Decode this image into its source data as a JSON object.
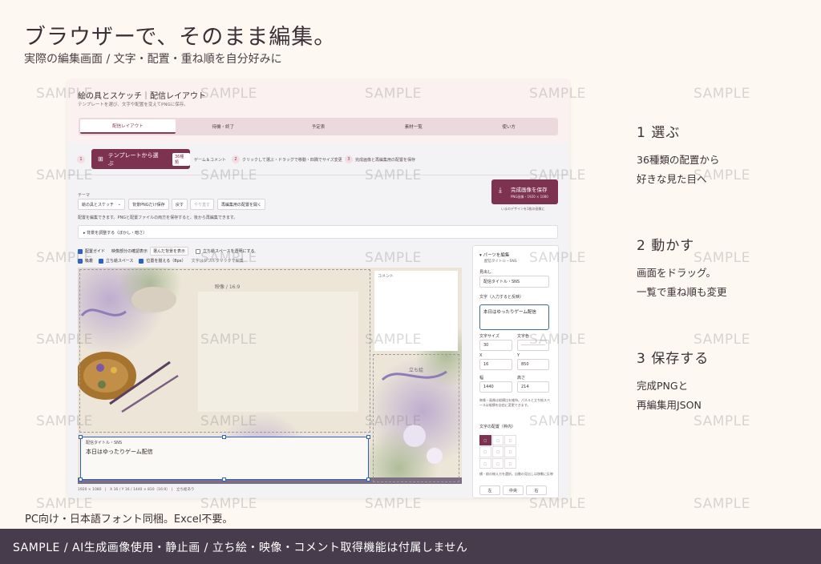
{
  "hero": {
    "title": "ブラウザーで、そのまま編集。",
    "subtitle": "実際の編集画面 / 文字・配置・重ね順を自分好みに"
  },
  "app": {
    "title": "絵の具とスケッチ｜配信レイアウト",
    "description": "テンプレートを選び、文字や配置を変えてPNGに保存。",
    "tabs": [
      "配信レイアウト",
      "待機・終了",
      "予定表",
      "素材一覧",
      "使い方"
    ],
    "steps": {
      "template_button": "テンプレートから選ぶ",
      "template_badge": "36種類",
      "after_button": "ゲーム＆コメント",
      "step2": "クリックして選ぶ・ドラッグで移動・四隅でサイズ変更",
      "step3": "完成画像と再編集用の配置を保存",
      "num1": "1",
      "num2": "2",
      "num3": "3"
    },
    "save": {
      "label": "完成画像を保存",
      "sub": "PNG画像・1920 × 1080",
      "note": "いまのデザインを1枚の画像に"
    },
    "theme_label": "テーマ",
    "controls": {
      "theme_select": "絵の具とスケッチ",
      "bg_png": "背景PNGだけ保存",
      "undo": "戻す",
      "redo": "やり直す",
      "load_layout": "再編集用の配置を開く"
    },
    "edit_hint": "配置を編集できます。PNGと配置ファイルの両方を保存すると、後から再編集できます。",
    "bg_adjust": "▸ 背景を調整する（ぼかし・暗さ）",
    "options": {
      "guide": "配置ガイド",
      "video_preview_label": "映像部分の確認表示",
      "video_preview_select": "選んだ背景を表示",
      "transparent": "立ち絵スペースを透明にする",
      "snap": "吸着",
      "stand_space": "立ち絵スペース",
      "align_grid": "位置を揃える（8px）",
      "hint": "文字はダブルクリックで編集"
    },
    "canvas": {
      "video_label": "映像 / 16:9",
      "comment_label": "コメント",
      "stand_label": "立ち絵",
      "title_small": "配信タイトル・SNS",
      "title_text": "本日はゆったりゲーム配信",
      "status": "1920 × 1080　|　X 16 / Y 16 / 1440 × 810（16:9）　|　立ち絵あり"
    },
    "panel": {
      "header": "▾ パーツを編集",
      "sub": "配信タイトル・SNS",
      "heading_label": "見出し",
      "heading_value": "配信タイトル・SNS",
      "text_label": "文字（入力すると反映）",
      "text_value": "本日はゆったりゲーム配信",
      "size_label": "文字サイズ",
      "size_value": "30",
      "color_label": "文字色",
      "x_label": "X",
      "x_value": "16",
      "y_label": "Y",
      "y_value": "850",
      "w_label": "幅",
      "w_value": "1440",
      "h_label": "高さ",
      "h_value": "214",
      "note1": "映像・画像は縦横比を維持。パネルと立ち絵スペースは縦横を自由に変更できます。",
      "align_label": "文字の配置（枠内）",
      "align_cell": "□",
      "note2": "横・縦の揃え方を選択。自動の見出しは移動に反映",
      "align_left": "左",
      "align_center": "中央",
      "align_right": "右"
    }
  },
  "sections": [
    {
      "title": "1  選ぶ",
      "desc": [
        "36種類の配置から",
        "好きな見た目へ"
      ]
    },
    {
      "title": "2  動かす",
      "desc": [
        "画面をドラッグ。",
        "一覧で重ね順も変更"
      ]
    },
    {
      "title": "3  保存する",
      "desc": [
        "完成PNGと",
        "再編集用JSON"
      ]
    }
  ],
  "footer_note": "PC向け・日本語フォント同梱。Excel不要。",
  "bottom_bar": "SAMPLE / AI生成画像使用・静止画 / 立ち絵・映像・コメント取得機能は付属しません",
  "watermark": "SAMPLE",
  "colors": {
    "background": "#fdf8f1",
    "accent": "#7d3350",
    "bottom_bar": "#473c4b",
    "selection": "#2b62c8"
  }
}
